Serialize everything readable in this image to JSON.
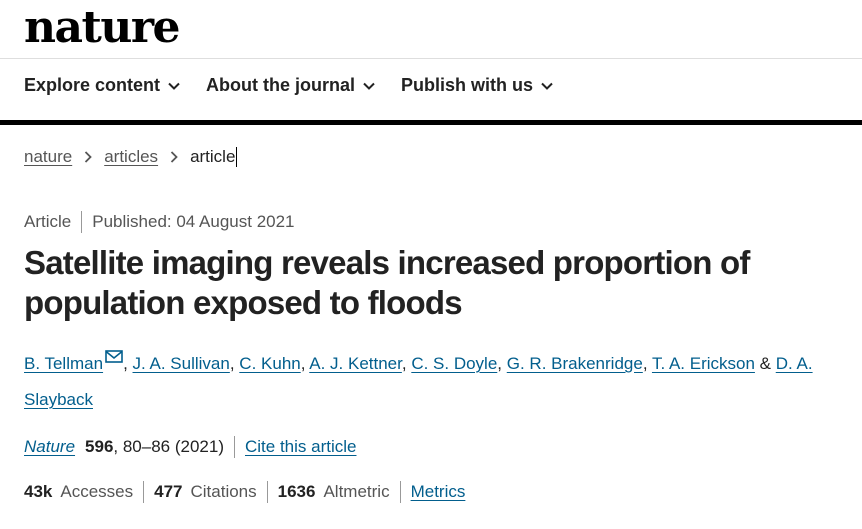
{
  "header": {
    "logo": "nature"
  },
  "nav": {
    "items": [
      {
        "label": "Explore content"
      },
      {
        "label": "About the journal"
      },
      {
        "label": "Publish with us"
      }
    ]
  },
  "breadcrumb": {
    "home": "nature",
    "section": "articles",
    "current": "article"
  },
  "article": {
    "type": "Article",
    "published": "Published: 04 August 2021",
    "title": "Satellite imaging reveals increased proportion of population exposed to floods",
    "authors": [
      "B. Tellman",
      "J. A. Sullivan",
      "C. Kuhn",
      "A. J. Kettner",
      "C. S. Doyle",
      "G. R. Brakenridge",
      "T. A. Erickson",
      "D. A. Slayback"
    ],
    "author_separator": ", ",
    "author_last_joiner": " & ",
    "journal": "Nature",
    "volume": "596",
    "pages_year": ", 80–86 (2021)",
    "cite_label": "Cite this article"
  },
  "metrics": {
    "accesses_value": "43k",
    "accesses_label": "Accesses",
    "citations_value": "477",
    "citations_label": "Citations",
    "altmetric_value": "1636",
    "altmetric_label": "Altmetric",
    "link_label": "Metrics"
  },
  "colors": {
    "link": "#025e8d",
    "text": "#222222",
    "muted": "#555555"
  },
  "icons": {
    "nav_chevron": "chevron-down-icon",
    "breadcrumb_sep": "chevron-right-icon",
    "author_mail": "mail-icon"
  }
}
